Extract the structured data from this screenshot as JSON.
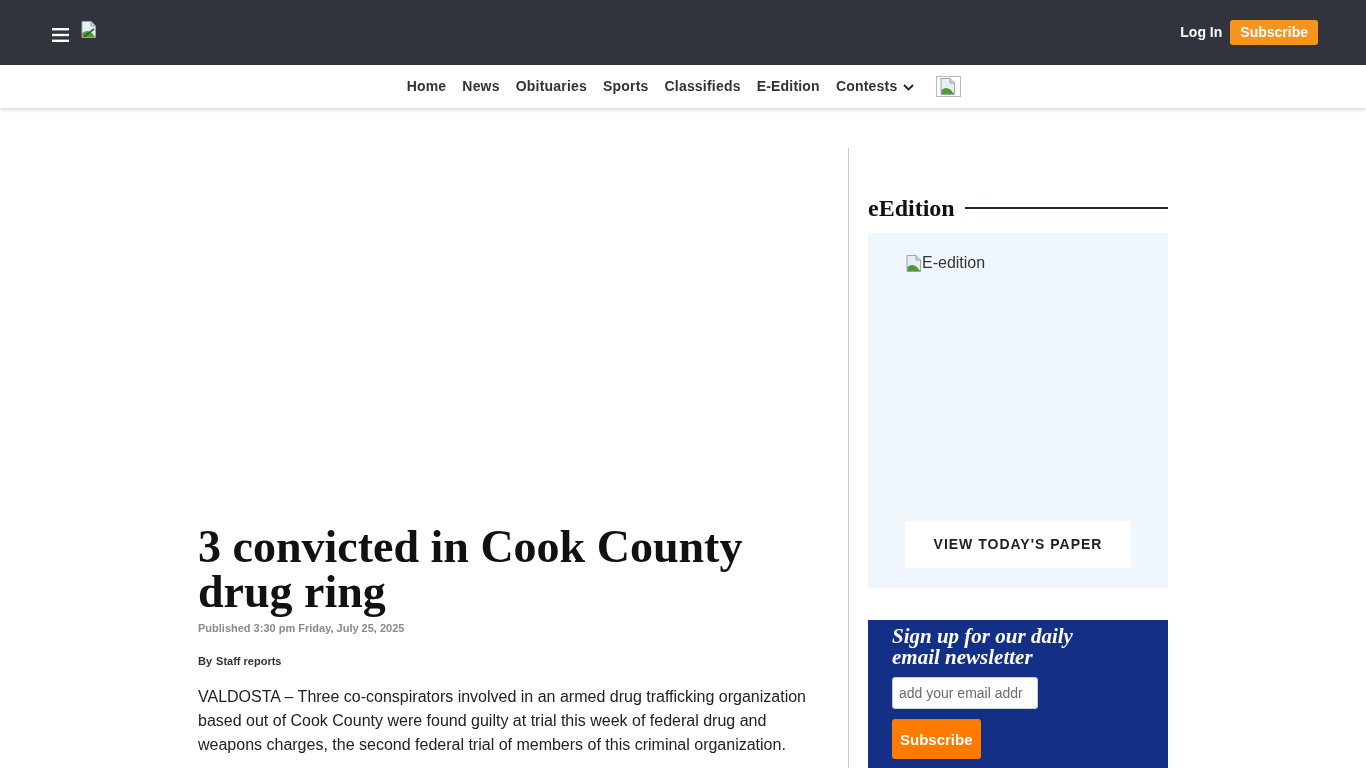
{
  "header": {
    "login": "Log In",
    "subscribe": "Subscribe"
  },
  "nav": {
    "items": [
      {
        "label": "Home",
        "has_dropdown": false
      },
      {
        "label": "News",
        "has_dropdown": false
      },
      {
        "label": "Obituaries",
        "has_dropdown": false
      },
      {
        "label": "Sports",
        "has_dropdown": false
      },
      {
        "label": "Classifieds",
        "has_dropdown": false
      },
      {
        "label": "E-Edition",
        "has_dropdown": false
      },
      {
        "label": "Contests",
        "has_dropdown": true
      }
    ]
  },
  "article": {
    "headline": "3 convicted in Cook County drug ring",
    "published": "Published 3:30 pm Friday, July 25, 2025",
    "byline_prefix": "By",
    "byline_author": "Staff reports",
    "paragraphs": [
      "VALDOSTA – Three co-conspirators involved in an armed drug trafficking organization based out of Cook County were found guilty at trial this week of federal drug and weapons charges, the second federal trial of members of this criminal organization."
    ]
  },
  "sidebar": {
    "eedition": {
      "heading": "eEdition",
      "image_alt": "E-edition",
      "button": "VIEW TODAY'S PAPER"
    },
    "newsletter": {
      "heading": "Sign up for our daily email newsletter",
      "placeholder": "add your email addr",
      "button": "Subscribe"
    }
  }
}
